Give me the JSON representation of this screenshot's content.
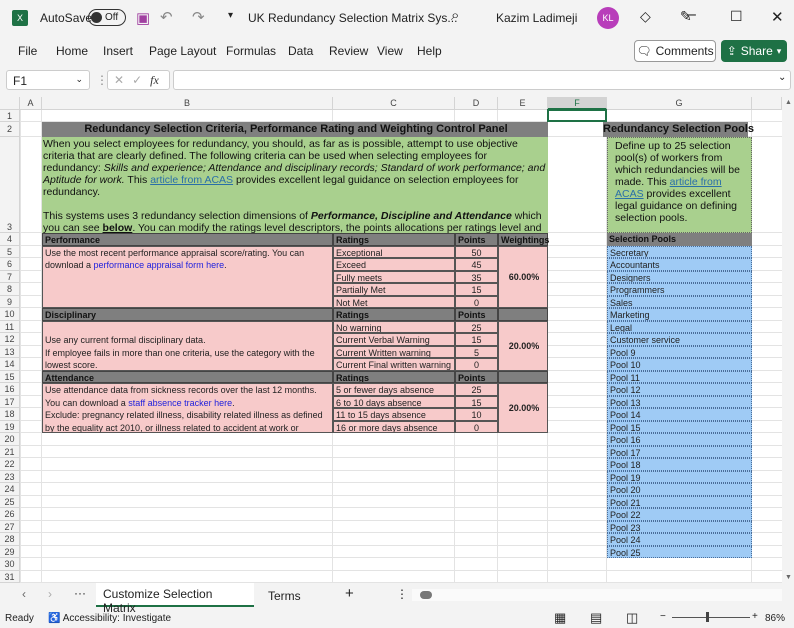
{
  "titlebar": {
    "autosave": "AutoSave",
    "toggle": "Off",
    "doc_title": "UK Redundancy Selection Matrix Sys...",
    "user": "Kazim Ladimeji",
    "initials": "KL"
  },
  "menu": [
    "File",
    "Home",
    "Insert",
    "Page Layout",
    "Formulas",
    "Data",
    "Review",
    "View",
    "Help"
  ],
  "buttons": {
    "comments": "Comments",
    "share": "Share"
  },
  "formula_bar": {
    "cell_ref": "F1",
    "value": ""
  },
  "columns": [
    "A",
    "B",
    "C",
    "D",
    "E",
    "F",
    "G"
  ],
  "sheet": {
    "panel_title": "Redundancy Selection Criteria, Performance Rating and Weighting Control Panel",
    "intro": {
      "p1a": "When you select employees for redundancy, you should, as far as is possible, attempt to use objective criteria that are clearly defined. The following criteria can be used when selecting employees for redundancy: ",
      "p1_italic": "Skills and experience; Attendance and disciplinary records; Standard of work performance; and Aptitude for work.",
      "p1b": " This ",
      "link": "article from ACAS",
      "p1c": " provides excellent legal guidance on selection employees for redundancy.",
      "p2a": "This systems uses 3 redundancy selection dimensions of ",
      "p2_bold": "Performance, Discipline and Attendance",
      "p2b": " which you can see ",
      "p2_below": "below",
      "p2c": ". You can modify the ratings level descriptors, the points allocations per ratings level and the weightings of each dimension in line with your needs or pre-existing redundancy selection arrangements."
    },
    "sections": [
      {
        "name": "Performance",
        "ratings_hdr": "Ratings",
        "points_hdr": "Points",
        "weight_hdr": "Weightings",
        "desc": [
          "Use the most recent performance appraisal score/rating. You can",
          "download a |performance appraisal form here|."
        ],
        "desc_offset": 0,
        "rows": [
          [
            "Exceptional",
            "50"
          ],
          [
            "Exceed",
            "45"
          ],
          [
            "Fully meets",
            "35"
          ],
          [
            "Partially Met",
            "15"
          ],
          [
            "Not Met",
            "0"
          ]
        ],
        "weighting": "60.00%"
      },
      {
        "name": "Disciplinary",
        "ratings_hdr": "Ratings",
        "points_hdr": "Points",
        "weight_hdr": "",
        "desc": [
          "Use any current formal disciplinary data.",
          "If employee fails in more than one criteria, use the category with the",
          "lowest score."
        ],
        "desc_offset": 1,
        "rows": [
          [
            "No warning",
            "25"
          ],
          [
            "Current Verbal Warning",
            "15"
          ],
          [
            "Current Written warning",
            "5"
          ],
          [
            "Current Final written warning",
            "0"
          ]
        ],
        "weighting": "20.00%"
      },
      {
        "name": "Attendance",
        "ratings_hdr": "Ratings",
        "points_hdr": "Points",
        "weight_hdr": "",
        "desc": [
          "Use attendance data from sickness records over the last 12 months.",
          "You can download a |staff absence tracker here|.",
          "Exclude: pregnancy related illness, disability related illness as defined",
          "by the equality act 2010, or illness related to accident at work or"
        ],
        "desc_offset": 0,
        "rows": [
          [
            "5 or fewer days absence",
            "25"
          ],
          [
            "6 to 10 days absence",
            "15"
          ],
          [
            "11 to 15 days absence",
            "10"
          ],
          [
            "16 or more days absence",
            "0"
          ]
        ],
        "weighting": "20.00%"
      }
    ],
    "pools_title": "Redundancy Selection Pools",
    "pools_intro": {
      "a": "Define up to 25 selection pool(s) of workers from which redundancies will be made. This ",
      "link": "article from ACAS",
      "b": " provides excellent legal guidance on defining selection pools."
    },
    "pools_header": "Selection Pools",
    "pools": [
      "Secretary",
      "Accountants",
      "Designers",
      "Programmers",
      "Sales",
      "Marketing",
      "Legal",
      "Customer service",
      "Pool 9",
      "Pool 10",
      "Pool 11",
      "Pool 12",
      "Pool 13",
      "Pool 14",
      "Pool 15",
      "Pool 16",
      "Pool 17",
      "Pool 18",
      "Pool 19",
      "Pool 20",
      "Pool 21",
      "Pool 22",
      "Pool 23",
      "Pool 24",
      "Pool 25"
    ]
  },
  "tabs": {
    "active": "Customize Selection Matrix",
    "other": "Terms"
  },
  "status": {
    "ready": "Ready",
    "accessibility": "Accessibility: Investigate",
    "zoom": "86%"
  }
}
